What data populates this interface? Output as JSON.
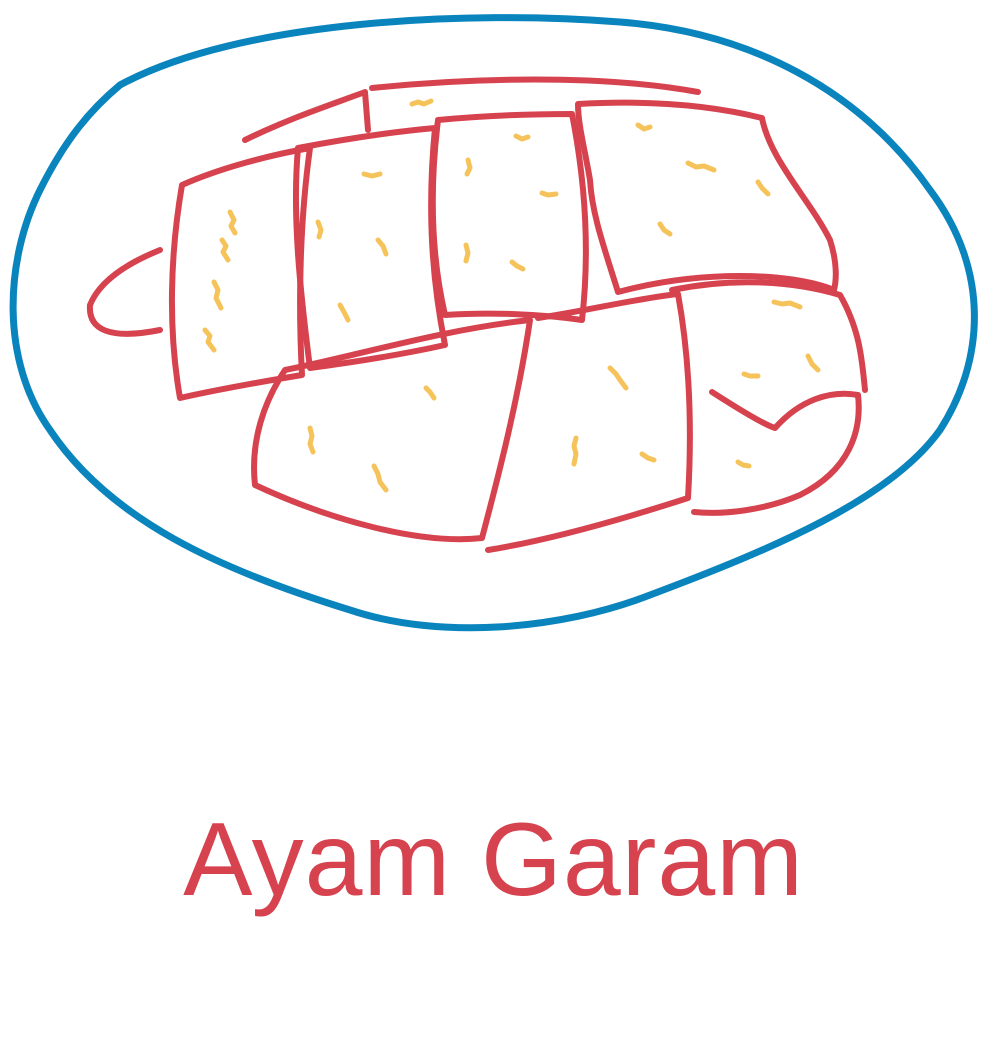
{
  "caption": "Ayam Garam",
  "colors": {
    "plate": "#0a84bd",
    "chicken": "#d6434f",
    "seasoning": "#f5c35a",
    "background": "#ffffff"
  },
  "icons": {
    "plate": "plate-icon",
    "chicken": "salted-chicken-icon",
    "seasoning": "seasoning-flakes-icon"
  }
}
